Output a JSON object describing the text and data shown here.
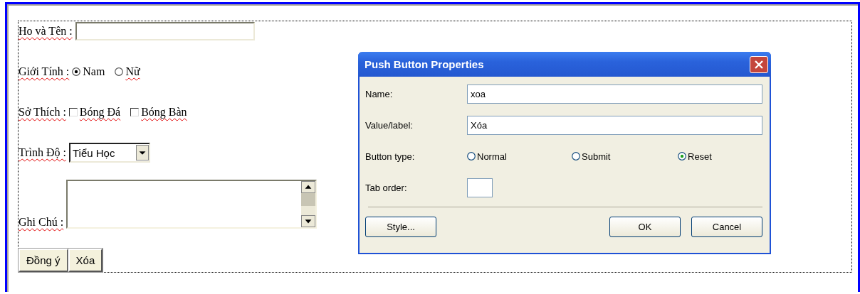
{
  "form": {
    "rows": [
      {
        "kind": "text",
        "label": "Ho và Tên :",
        "misspelled": true
      },
      {
        "kind": "radio",
        "label": "Giới Tính :",
        "misspelled": true,
        "options": [
          {
            "label": "Nam",
            "selected": true,
            "misspelled": false
          },
          {
            "label": "Nữ",
            "selected": false,
            "misspelled": true
          }
        ]
      },
      {
        "kind": "checkbox",
        "label": "Sở Thích :",
        "misspelled": true,
        "options": [
          {
            "label": "Bóng Đá",
            "checked": false,
            "misspelled": true
          },
          {
            "label": "Bóng Bàn",
            "checked": false,
            "misspelled": true
          }
        ]
      },
      {
        "kind": "select",
        "label": "Trình Độ :",
        "misspelled": true,
        "value": "Tiểu Học"
      },
      {
        "kind": "textarea",
        "label": "Ghi Chú :",
        "misspelled": true
      }
    ],
    "buttons": [
      "Đồng ý",
      "Xóa"
    ]
  },
  "dialog": {
    "title": "Push Button Properties",
    "fields": [
      {
        "label": "Name:",
        "value": "xoa"
      },
      {
        "label": "Value/label:",
        "value": "Xóa"
      }
    ],
    "button_type": {
      "label": "Button type:",
      "options": [
        {
          "label": "Normal",
          "selected": false
        },
        {
          "label": "Submit",
          "selected": false
        },
        {
          "label": "Reset",
          "selected": true
        }
      ]
    },
    "tab_order": {
      "label": "Tab order:"
    },
    "buttons": [
      "Style...",
      "OK",
      "Cancel"
    ]
  }
}
